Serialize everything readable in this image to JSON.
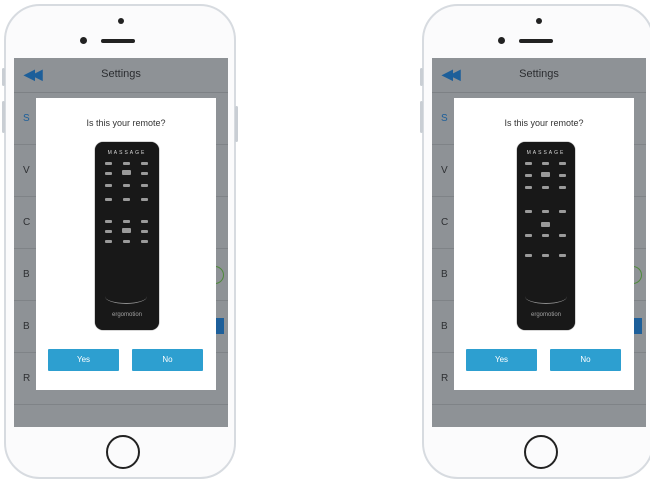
{
  "phones": [
    {
      "nav": {
        "back_icon": "double-chevron-left-icon",
        "title": "Settings"
      },
      "row_letters": [
        "S",
        "V",
        "C",
        "B",
        "B",
        "R"
      ],
      "dialog": {
        "question": "Is this your remote?",
        "yes_label": "Yes",
        "no_label": "No",
        "remote": {
          "header": "MASSAGE",
          "brand": "ergomotion"
        }
      }
    },
    {
      "nav": {
        "back_icon": "double-chevron-left-icon",
        "title": "Settings"
      },
      "row_letters": [
        "S",
        "V",
        "C",
        "B",
        "B",
        "R"
      ],
      "dialog": {
        "question": "Is this your remote?",
        "yes_label": "Yes",
        "no_label": "No",
        "remote": {
          "header": "MASSAGE",
          "brand": "ergomotion"
        }
      }
    }
  ],
  "colors": {
    "accent": "#2d9fd0",
    "nav_icon": "#1d5f9a",
    "overlay": "#8e9296",
    "remote_body": "#181818"
  }
}
